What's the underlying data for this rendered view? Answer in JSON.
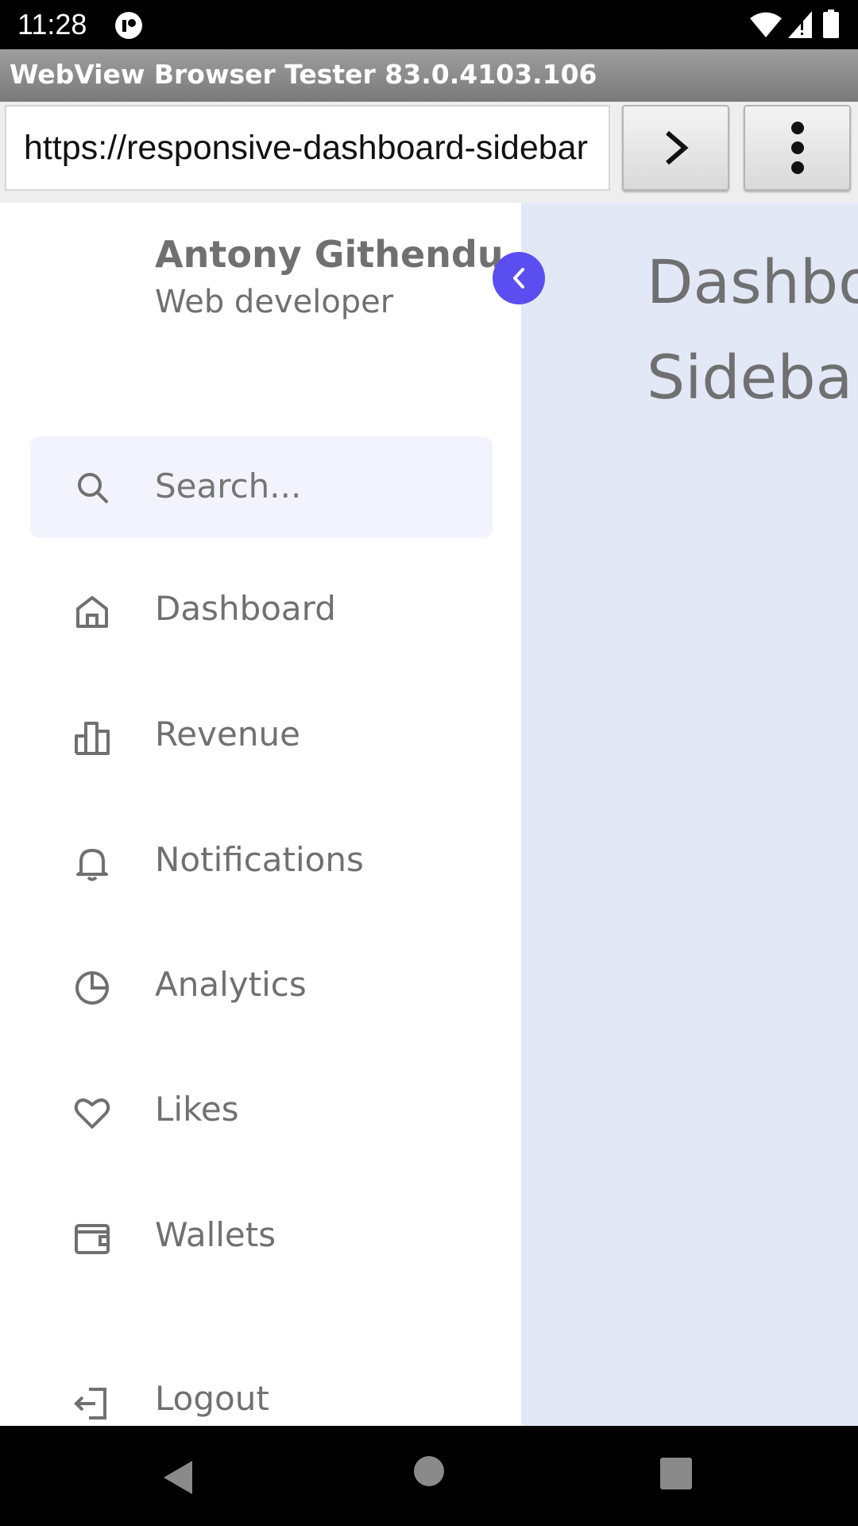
{
  "status_bar": {
    "time": "11:28"
  },
  "app_bar": {
    "title": "WebView Browser Tester 83.0.4103.106"
  },
  "url_bar": {
    "url": "https://responsive-dashboard-sidebar"
  },
  "sidebar": {
    "profile": {
      "name": "Antony Githendu",
      "role": "Web developer"
    },
    "search": {
      "placeholder": "Search..."
    },
    "items": [
      {
        "label": "Dashboard",
        "icon": "home-icon"
      },
      {
        "label": "Revenue",
        "icon": "bar-chart-icon"
      },
      {
        "label": "Notifications",
        "icon": "bell-icon"
      },
      {
        "label": "Analytics",
        "icon": "pie-chart-icon"
      },
      {
        "label": "Likes",
        "icon": "heart-icon"
      },
      {
        "label": "Wallets",
        "icon": "wallet-icon"
      }
    ],
    "logout": {
      "label": "Logout",
      "icon": "logout-icon"
    }
  },
  "main": {
    "title_line1": "Dashboard",
    "title_line2": "Sidebar"
  },
  "colors": {
    "accent": "#5b4ef0",
    "content_bg": "#e3e8f7",
    "text": "#707070",
    "search_bg": "#f3f3fd"
  }
}
